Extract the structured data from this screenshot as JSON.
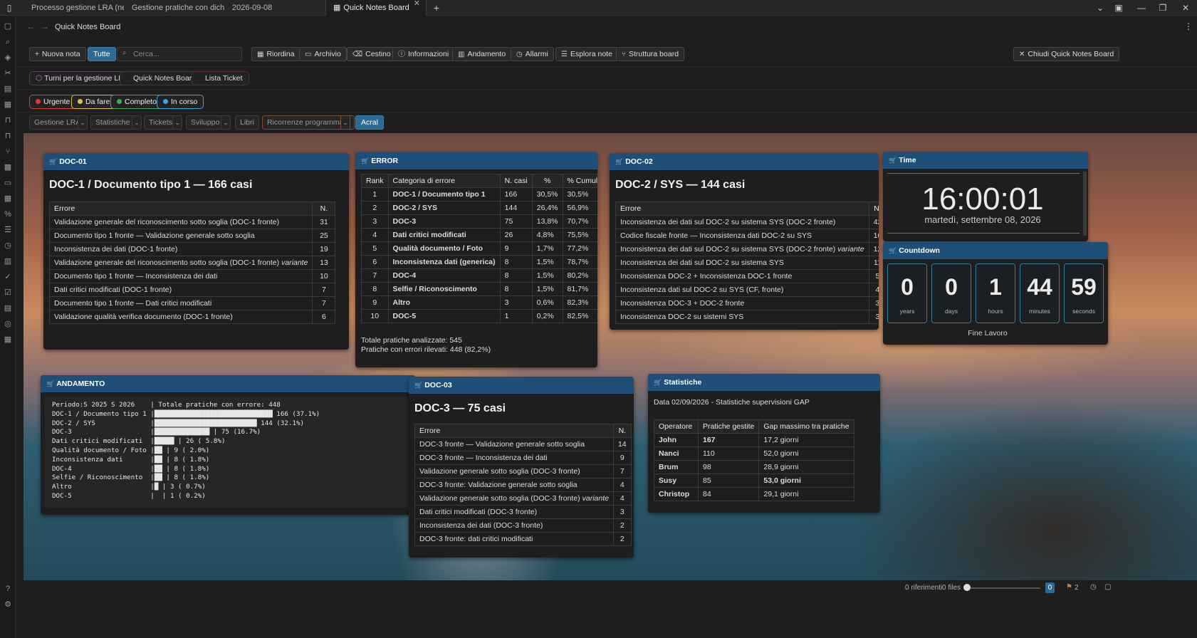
{
  "tabs": [
    {
      "label": "Processo gestione LRA (ne...",
      "pinned": true
    },
    {
      "label": "Gestione pratiche con dich...",
      "pinned": true
    },
    {
      "label": "2026-09-08",
      "pinned": false
    },
    {
      "label": "Quick Notes Board",
      "pinned": false,
      "active": true
    }
  ],
  "nav": {
    "title": "Quick Notes Board"
  },
  "toolbar": {
    "new_note": "Nuova nota",
    "all": "Tutte",
    "search_placeholder": "Cerca...",
    "buttons": [
      "Riordina",
      "Archivio",
      "Cestino",
      "Informazioni",
      "Andamento",
      "Allarmi",
      "Esplora note",
      "Struttura board"
    ],
    "close_board": "Chiudi Quick Notes Board"
  },
  "boards": [
    "Turni per la gestione LRA",
    "Quick Notes Board",
    "Lista Ticket"
  ],
  "status_tags": [
    {
      "label": "Urgente",
      "color": "#e03a3a"
    },
    {
      "label": "Da fare",
      "color": "#e0c23a"
    },
    {
      "label": "Completo",
      "color": "#3ab04a"
    },
    {
      "label": "In corso",
      "color": "#3aa6e0"
    }
  ],
  "categories": [
    "Gestione LRA",
    "Statistiche",
    "Tickets",
    "Sviluppo",
    "Libri",
    "Ricorrenze programmate",
    "Acral"
  ],
  "doc01": {
    "header": "DOC-01",
    "title": "DOC-1 / Documento tipo 1 — 166 casi",
    "col_error": "Errore",
    "col_n": "N.",
    "rows": [
      {
        "e": "Validazione generale del riconoscimento sotto soglia (DOC-1 fronte)",
        "v": "",
        "n": "31"
      },
      {
        "e": "Documento tipo 1 fronte — Validazione generale sotto soglia",
        "v": "",
        "n": "25"
      },
      {
        "e": "Inconsistenza dei dati (DOC-1 fronte)",
        "v": "",
        "n": "19"
      },
      {
        "e": "Validazione generale del riconoscimento sotto soglia (DOC-1 fronte)",
        "v": "variante",
        "n": "13"
      },
      {
        "e": "Documento tipo 1 fronte — Inconsistenza dei dati",
        "v": "",
        "n": "10"
      },
      {
        "e": "Dati critici modificati (DOC-1 fronte)",
        "v": "",
        "n": "7"
      },
      {
        "e": "Documento tipo 1 fronte — Dati critici modificati",
        "v": "",
        "n": "7"
      },
      {
        "e": "Validazione qualità verifica documento (DOC-1 fronte)",
        "v": "",
        "n": "6"
      }
    ]
  },
  "error": {
    "header": "ERROR",
    "cols": [
      "Rank",
      "Categoria di errore",
      "N. casi",
      "%",
      "% Cumulativa"
    ],
    "rows": [
      [
        "1",
        "DOC-1 / Documento tipo 1",
        "166",
        "30,5%",
        "30,5%"
      ],
      [
        "2",
        "DOC-2 / SYS",
        "144",
        "26,4%",
        "56,9%"
      ],
      [
        "3",
        "DOC-3",
        "75",
        "13,8%",
        "70,7%"
      ],
      [
        "4",
        "Dati critici modificati",
        "26",
        "4,8%",
        "75,5%"
      ],
      [
        "5",
        "Qualità documento / Foto",
        "9",
        "1,7%",
        "77,2%"
      ],
      [
        "6",
        "Inconsistenza dati (generica)",
        "8",
        "1,5%",
        "78,7%"
      ],
      [
        "7",
        "DOC-4",
        "8",
        "1,5%",
        "80,2%"
      ],
      [
        "8",
        "Selfie / Riconoscimento",
        "8",
        "1,5%",
        "81,7%"
      ],
      [
        "9",
        "Altro",
        "3",
        "0,6%",
        "82,3%"
      ],
      [
        "10",
        "DOC-5",
        "1",
        "0,2%",
        "82,5%"
      ]
    ],
    "total1": "Totale pratiche analizzate: 545",
    "total2": "Pratiche con errori rilevati: 448 (82,2%)"
  },
  "doc02": {
    "header": "DOC-02",
    "title": "DOC-2 / SYS — 144 casi",
    "col_error": "Errore",
    "col_n": "N.",
    "rows": [
      {
        "e": "Inconsistenza dei dati sul DOC-2 su sistema SYS (DOC-2 fronte)",
        "v": "",
        "n": "42"
      },
      {
        "e": "Codice fiscale fronte — Inconsistenza dati DOC-2 su SYS",
        "v": "",
        "n": "16"
      },
      {
        "e": "Inconsistenza dei dati sul DOC-2 su sistema SYS (DOC-2 fronte)",
        "v": "variante",
        "n": "12"
      },
      {
        "e": "Inconsistenza dei dati sul DOC-2 su sistema SYS",
        "v": "",
        "n": "11"
      },
      {
        "e": "Inconsistenza DOC-2 + Inconsistenza DOC-1 fronte",
        "v": "",
        "n": "5"
      },
      {
        "e": "Inconsistenza dati sul DOC-2 su SYS (CF, fronte)",
        "v": "",
        "n": "4"
      },
      {
        "e": "Inconsistenza DOC-3 + DOC-2 fronte",
        "v": "",
        "n": "3"
      },
      {
        "e": "Inconsistenza DOC-2 su sistemi SYS",
        "v": "",
        "n": "3"
      }
    ]
  },
  "time": {
    "header": "Time",
    "clock": "16:00:01",
    "date": "martedì, settembre 08, 2026"
  },
  "countdown": {
    "header": "Countdown",
    "units": [
      {
        "n": "0",
        "l": "years"
      },
      {
        "n": "0",
        "l": "days"
      },
      {
        "n": "1",
        "l": "hours"
      },
      {
        "n": "44",
        "l": "minutes"
      },
      {
        "n": "59",
        "l": "seconds"
      }
    ],
    "caption": "Fine Lavoro"
  },
  "andamento": {
    "header": "ANDAMENTO",
    "lines": [
      "Periodo:S 2025 S 2026    | Totale pratiche con errore: 448",
      "DOC-1 / Documento tipo 1 |██████████████████████████████ 166 (37.1%)",
      "DOC-2 / SYS              |██████████████████████████ 144 (32.1%)",
      "DOC-3                    |██████████████ | 75 (16.7%)",
      "Dati critici modificati  |█████ | 26 ( 5.8%)",
      "Qualità documento / Foto |██ | 9 ( 2.0%)",
      "Inconsistenza dati       |██ | 8 ( 1.8%)",
      "DOC-4                    |██ | 8 ( 1.8%)",
      "Selfie / Riconoscimento  |██ | 8 ( 1.8%)",
      "Altro                    |█ | 3 ( 0.7%)",
      "DOC-5                    |  | 1 ( 0.2%)"
    ]
  },
  "doc03": {
    "header": "DOC-03",
    "title": "DOC-3 — 75 casi",
    "col_error": "Errore",
    "col_n": "N.",
    "rows": [
      {
        "e": "DOC-3 fronte — Validazione generale sotto soglia",
        "v": "",
        "n": "14"
      },
      {
        "e": "DOC-3 fronte — Inconsistenza dei dati",
        "v": "",
        "n": "9"
      },
      {
        "e": "Validazione generale sotto soglia (DOC-3 fronte)",
        "v": "",
        "n": "7"
      },
      {
        "e": "DOC-3 fronte: Validazione generale sotto soglia",
        "v": "",
        "n": "4"
      },
      {
        "e": "Validazione generale sotto soglia (DOC-3 fronte)",
        "v": "variante",
        "n": "4"
      },
      {
        "e": "Dati critici modificati (DOC-3 fronte)",
        "v": "",
        "n": "3"
      },
      {
        "e": "Inconsistenza dei dati (DOC-3 fronte)",
        "v": "",
        "n": "2"
      },
      {
        "e": "DOC-3 fronte: dati critici modificati",
        "v": "",
        "n": "2"
      }
    ]
  },
  "statistiche": {
    "header": "Statistiche",
    "subtitle": "Data 02/09/2026 - Statistiche supervisioni GAP",
    "cols": [
      "Operatore",
      "Pratiche gestite",
      "Gap massimo tra pratiche"
    ],
    "rows": [
      [
        "John",
        "167",
        "17,2 giorni"
      ],
      [
        "Nanci",
        "110",
        "52,0 giorni"
      ],
      [
        "Brum",
        "98",
        "28,9 giorni"
      ],
      [
        "Susy",
        "85",
        "53,0 giorni"
      ],
      [
        "Christop",
        "84",
        "29,1 giorni"
      ]
    ]
  },
  "status": {
    "refs": "0 riferimenti",
    "files": "0 files",
    "badge": "0",
    "count": "2"
  },
  "icons": {
    "accent": "#1f4e78"
  }
}
